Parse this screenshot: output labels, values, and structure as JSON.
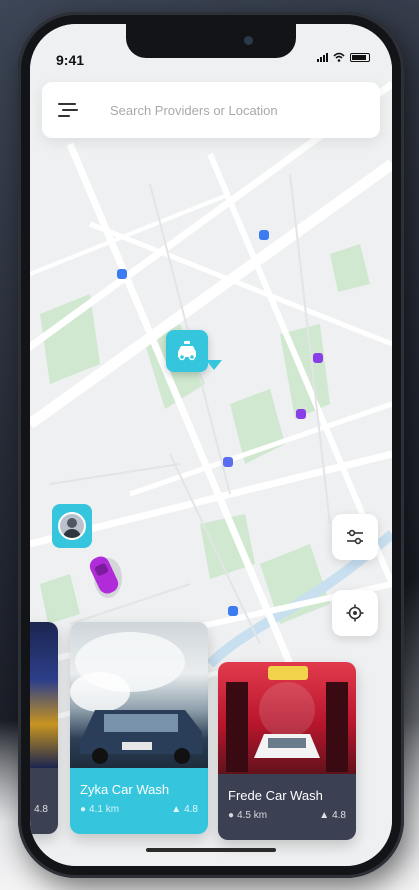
{
  "status_bar": {
    "time": "9:41"
  },
  "search": {
    "placeholder": "Search Providers or Location"
  },
  "providers": [
    {
      "name": "",
      "distance": "",
      "rating": "4.8"
    },
    {
      "name": "Zyka Car Wash",
      "distance": "4.1 km",
      "rating": "4.8"
    },
    {
      "name": "Frede Car Wash",
      "distance": "4.5 km",
      "rating": "4.8"
    }
  ],
  "colors": {
    "accent": "#35c6dd",
    "marker_blue": "#3d7bf0",
    "marker_purple": "#8a3ee8",
    "map_bg": "#eef0f1",
    "park_green": "#cfe8cf",
    "card_dark": "#3b4052"
  },
  "icons": {
    "menu": "menu-icon",
    "filter": "filter-sliders-icon",
    "locate": "locate-target-icon",
    "car_wash": "car-wash-icon",
    "location": "location-pin-icon",
    "thumbs_up": "thumbs-up-icon"
  }
}
